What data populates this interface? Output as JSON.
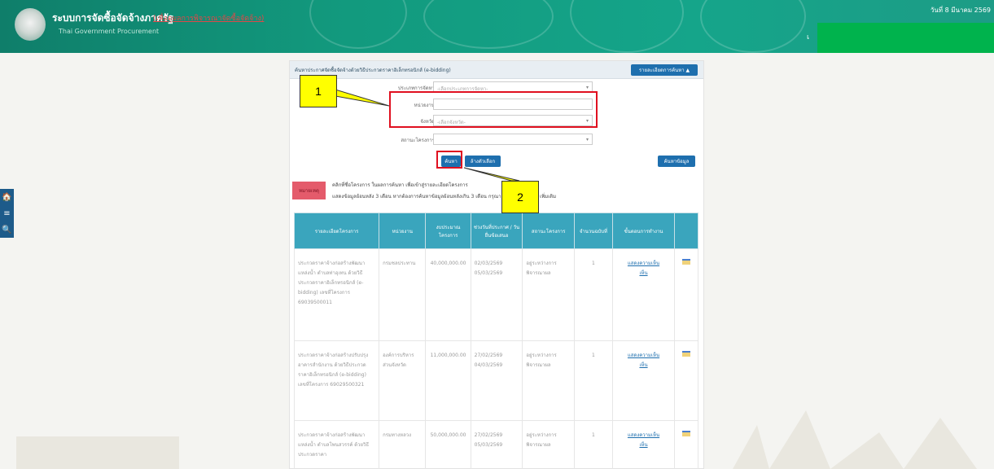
{
  "header": {
    "title": "ระบบการจัดซื้อจัดจ้างภาครัฐ",
    "subtitle_red": "(เพื่อดูผลการพิจารณาจัดซื้อจัดจ้าง)",
    "subtitle_en": "Thai Government Procurement",
    "date": "วันที่ 8 มีนาคม 2569",
    "e_label": "เ"
  },
  "side_tools": {
    "home": "🏠",
    "menu": "≡",
    "search": "🔍"
  },
  "panel": {
    "title": "ค้นหาประกาศจัดซื้อจัดจ้างด้วยวิธีประกวดราคาอิเล็กทรอนิกส์ (e-bidding)",
    "advanced_search": "รายละเอียดการค้นหา ▲",
    "fields": [
      {
        "label": "ประเภทการจัดหา",
        "placeholder": "-เลือกประเภทการจัดหา-"
      },
      {
        "label": "หน่วยงาน",
        "placeholder": ""
      },
      {
        "label": "จังหวัด",
        "placeholder": "-เลือกจังหวัด-"
      },
      {
        "label": "สถานะโครงการ",
        "placeholder": ""
      }
    ],
    "search_button": "ค้นหา",
    "clear_button": "ล้างตัวเลือก",
    "all_data_button": "ค้นหาข้อมูล",
    "note_tag": "หมายเหตุ",
    "note_line1": "คลิกที่ชื่อโครงการ ในผลการค้นหา เพื่อเข้าสู่รายละเอียดโครงการ",
    "note_line2": "แสดงข้อมูลย้อนหลัง 3 เดือน หากต้องการค้นหาข้อมูลย้อนหลังเกิน 3 เดือน กรุณาเลือก ค้นหาข้อมูล เพิ่มเติม"
  },
  "table": {
    "headers": [
      "รายละเอียดโครงการ",
      "หน่วยงาน",
      "งบประมาณโครงการ",
      "ช่วงวันที่ประกาศ / วันยื่นข้อเสนอ",
      "สถานะโครงการ",
      "จำนวนฉบับที่",
      "ขั้นตอนการทำงาน",
      ""
    ],
    "rows": [
      {
        "name": "ประกวดราคาจ้างก่อสร้างพัฒนาแหล่งน้ำ ตำบลท่าอุเทน ด้วยวิธีประกวดราคาอิเล็กทรอนิกส์ (e-bidding) เลขที่โครงการ 69039500011",
        "agency": "กรมชลประทาน",
        "budget": "40,000,000.00",
        "date1": "02/03/2569",
        "date2": "05/03/2569",
        "status": "อยู่ระหว่างการพิจารณาผล",
        "count": "1",
        "step": "แสดงความเห็น",
        "step2": "เห็น"
      },
      {
        "name": "ประกวดราคาจ้างก่อสร้างปรับปรุงอาคารสำนักงาน ด้วยวิธีประกวดราคาอิเล็กทรอนิกส์ (e-bidding) เลขที่โครงการ 69029500321",
        "agency": "องค์การบริหารส่วนจังหวัด",
        "budget": "11,000,000.00",
        "date1": "27/02/2569",
        "date2": "04/03/2569",
        "status": "อยู่ระหว่างการพิจารณาผล",
        "count": "1",
        "step": "แสดงความเห็น",
        "step2": "เห็น"
      },
      {
        "name": "ประกวดราคาจ้างก่อสร้างพัฒนาแหล่งน้ำ ตำบลโพนสวรรค์ ด้วยวิธีประกวดราคา",
        "agency": "กรมทางหลวง",
        "budget": "50,000,000.00",
        "date1": "27/02/2569",
        "date2": "05/03/2569",
        "status": "อยู่ระหว่างการพิจารณาผล",
        "count": "1",
        "step": "แสดงความเห็น",
        "step2": "เห็น"
      }
    ]
  },
  "callouts": {
    "one": "1",
    "two": "2"
  },
  "colors": {
    "header": "#129a7e",
    "accent": "#1e6fae",
    "table_header": "#3aa5bd",
    "highlight": "#ffff00",
    "red_box": "#e01020",
    "green_block": "#00b34d"
  }
}
